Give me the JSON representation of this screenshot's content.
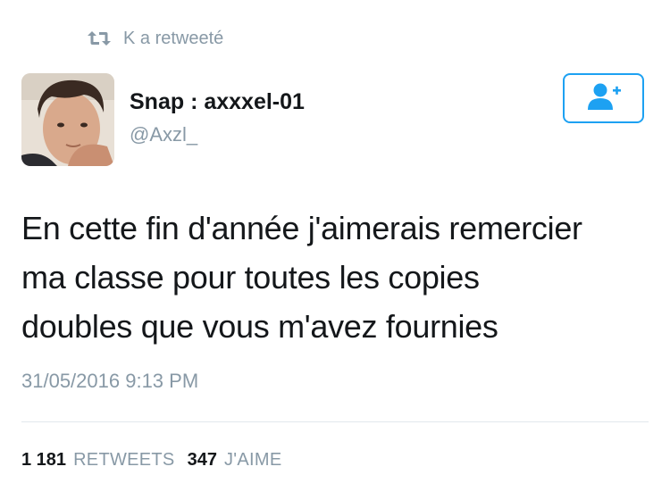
{
  "retweet": {
    "text": "K a retweeté",
    "icon": "retweet-icon"
  },
  "author": {
    "display_name": "Snap : axxxel-01",
    "handle": "@Axzl_"
  },
  "follow_button": {
    "icon": "add-user-icon",
    "accent_color": "#1da1f2"
  },
  "tweet": {
    "lines": [
      "En cette fin d'année j'aimerais remercier",
      "ma classe pour toutes les copies",
      "doubles que vous m'avez fournies"
    ],
    "timestamp": "31/05/2016 9:13 PM"
  },
  "stats": {
    "retweets_count": "1 181",
    "retweets_label": "RETWEETS",
    "likes_count": "347",
    "likes_label": "J'AIME"
  },
  "colors": {
    "text": "#14171a",
    "muted": "#8899a6",
    "accent": "#1da1f2",
    "divider": "#e1e8ed"
  }
}
